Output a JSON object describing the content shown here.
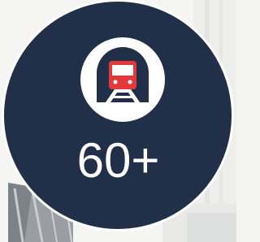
{
  "stat": {
    "value": "60+",
    "icon": "train-tunnel-icon"
  },
  "colors": {
    "badge_background": "#213048",
    "badge_border": "#ffffff",
    "icon_background": "#ffffff",
    "icon_tunnel": "#213048",
    "icon_train": "#e23a3a",
    "text": "#ffffff"
  }
}
